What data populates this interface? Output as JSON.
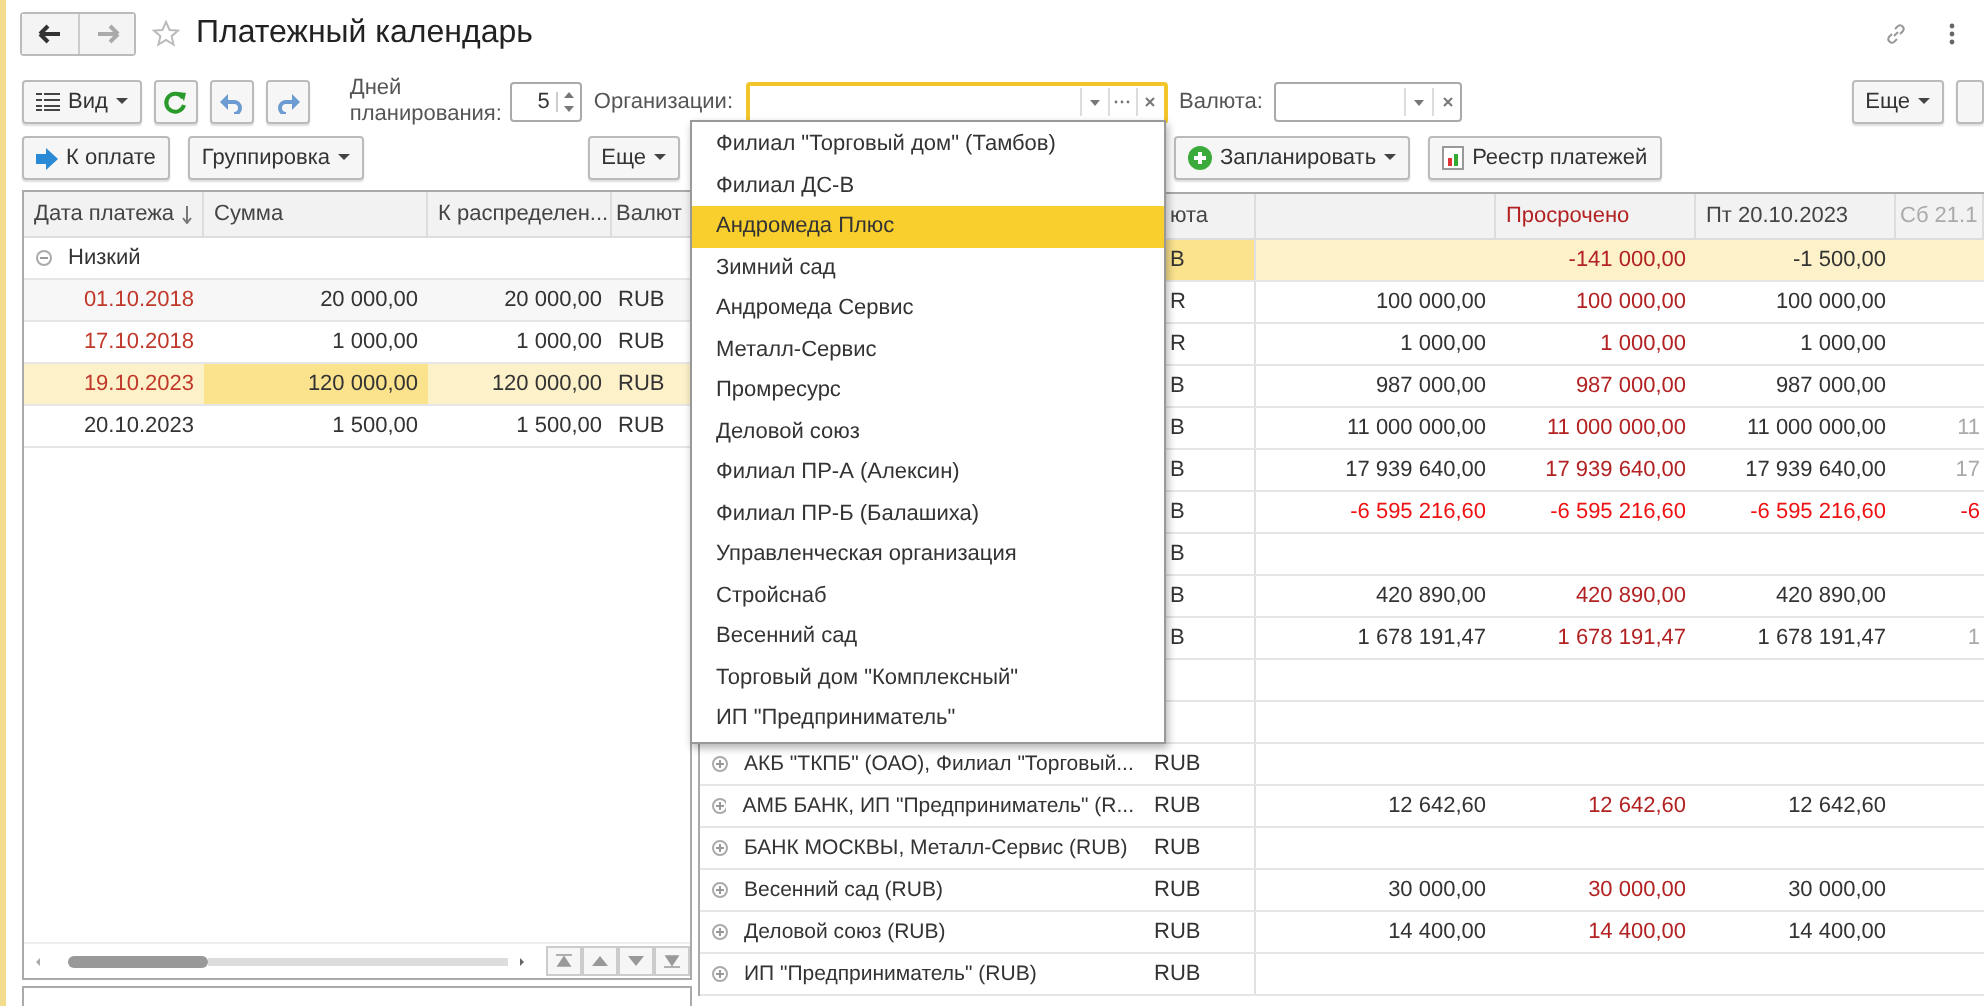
{
  "window": {
    "title": "Платежный календарь"
  },
  "toolbar": {
    "view_button": "Вид",
    "days_label": "Дней планирования:",
    "days_value": "5",
    "org_label": "Организации:",
    "currency_label": "Валюта:",
    "more_button": "Еще"
  },
  "left": {
    "pay_button": "К оплате",
    "group_button": "Группировка",
    "more_button": "Еще",
    "columns": [
      "Дата платежа",
      "Сумма",
      "К распределен...",
      "Валют"
    ],
    "group": {
      "label": "Низкий",
      "expanded": true
    },
    "rows": [
      {
        "date": "01.10.2018",
        "overdue": true,
        "sum": "20 000,00",
        "to_distribute": "20 000,00",
        "currency": "RUB",
        "selected": false
      },
      {
        "date": "17.10.2018",
        "overdue": true,
        "sum": "1 000,00",
        "to_distribute": "1 000,00",
        "currency": "RUB",
        "selected": false
      },
      {
        "date": "19.10.2023",
        "overdue": true,
        "sum": "120 000,00",
        "to_distribute": "120 000,00",
        "currency": "RUB",
        "selected": true
      },
      {
        "date": "20.10.2023",
        "overdue": false,
        "sum": "1 500,00",
        "to_distribute": "1 500,00",
        "currency": "RUB",
        "selected": false
      }
    ]
  },
  "right": {
    "plan_button": "Запланировать",
    "registry_button": "Реестр платежей",
    "columns": [
      {
        "label": "юта",
        "kind": "plain"
      },
      {
        "kind": "plain"
      },
      {
        "label": "Просрочено",
        "kind": "overdue"
      },
      {
        "label": "Пт 20.10.2023",
        "kind": "plain"
      },
      {
        "label": "Сб 21.1",
        "kind": "weekend"
      }
    ],
    "rows": [
      {
        "currency": "B",
        "overdue": "-141 000,00",
        "day_1": "-1 500,00",
        "negative": false,
        "selected": true
      },
      {
        "currency": "R",
        "amount": "100 000,00",
        "overdue": "100 000,00",
        "day_1": "100 000,00",
        "negative": false,
        "selected": false
      },
      {
        "currency": "R",
        "amount": "1 000,00",
        "overdue": "1 000,00",
        "day_1": "1 000,00",
        "negative": false,
        "selected": false
      },
      {
        "currency": "B",
        "amount": "987 000,00",
        "overdue": "987 000,00",
        "day_1": "987 000,00",
        "negative": false,
        "selected": false
      },
      {
        "currency": "B",
        "amount": "11 000 000,00",
        "overdue": "11 000 000,00",
        "day_1": "11 000 000,00",
        "day_2": "11",
        "negative": false,
        "selected": false
      },
      {
        "currency": "B",
        "amount": "17 939 640,00",
        "overdue": "17 939 640,00",
        "day_1": "17 939 640,00",
        "day_2": "17",
        "negative": false,
        "selected": false
      },
      {
        "currency": "B",
        "amount": "-6 595 216,60",
        "overdue": "-6 595 216,60",
        "day_1": "-6 595 216,60",
        "day_2": "-6",
        "negative": true,
        "selected": false
      },
      {
        "currency": "B",
        "selected": false
      },
      {
        "currency": "B",
        "amount": "420 890,00",
        "overdue": "420 890,00",
        "day_1": "420 890,00",
        "negative": false,
        "selected": false
      },
      {
        "currency": "B",
        "amount": "1 678 191,47",
        "overdue": "1 678 191,47",
        "day_1": "1 678 191,47",
        "day_2": "1",
        "negative": false,
        "selected": false
      },
      {
        "selected": false
      },
      {
        "selected": false
      },
      {
        "name": "АКБ \"ТКПБ\" (ОАО), Филиал \"Торговый...",
        "currency": "RUB",
        "selected": false
      },
      {
        "name": "АМБ БАНК, ИП \"Предприниматель\" (R...",
        "currency": "RUB",
        "amount": "12 642,60",
        "overdue": "12 642,60",
        "day_1": "12 642,60",
        "negative": false,
        "selected": false
      },
      {
        "name": "БАНК МОСКВЫ, Металл-Сервис (RUB)",
        "currency": "RUB",
        "selected": false
      },
      {
        "name": "Весенний сад (RUB)",
        "currency": "RUB",
        "amount": "30 000,00",
        "overdue": "30 000,00",
        "day_1": "30 000,00",
        "negative": false,
        "selected": false
      },
      {
        "name": "Деловой союз (RUB)",
        "currency": "RUB",
        "amount": "14 400,00",
        "overdue": "14 400,00",
        "day_1": "14 400,00",
        "negative": false,
        "selected": false
      },
      {
        "name": "ИП \"Предприниматель\" (RUB)",
        "currency": "RUB",
        "selected": false
      }
    ]
  },
  "dropdown": {
    "items": [
      {
        "label": "Филиал \"Торговый дом\" (Тамбов)",
        "selected": false
      },
      {
        "label": "Филиал ДС-В",
        "selected": false
      },
      {
        "label": "Андромеда Плюс",
        "selected": true
      },
      {
        "label": "Зимний сад",
        "selected": false
      },
      {
        "label": "Андромеда Сервис",
        "selected": false
      },
      {
        "label": "Металл-Сервис",
        "selected": false
      },
      {
        "label": "Промресурс",
        "selected": false
      },
      {
        "label": "Деловой союз",
        "selected": false
      },
      {
        "label": "Филиал ПР-А (Алексин)",
        "selected": false
      },
      {
        "label": "Филиал ПР-Б (Балашиха)",
        "selected": false
      },
      {
        "label": "Управленческая организация",
        "selected": false
      },
      {
        "label": "Стройснаб",
        "selected": false
      },
      {
        "label": "Весенний сад",
        "selected": false
      },
      {
        "label": "Торговый дом \"Комплексный\"",
        "selected": false
      },
      {
        "label": "ИП \"Предприниматель\"",
        "selected": false
      }
    ]
  }
}
